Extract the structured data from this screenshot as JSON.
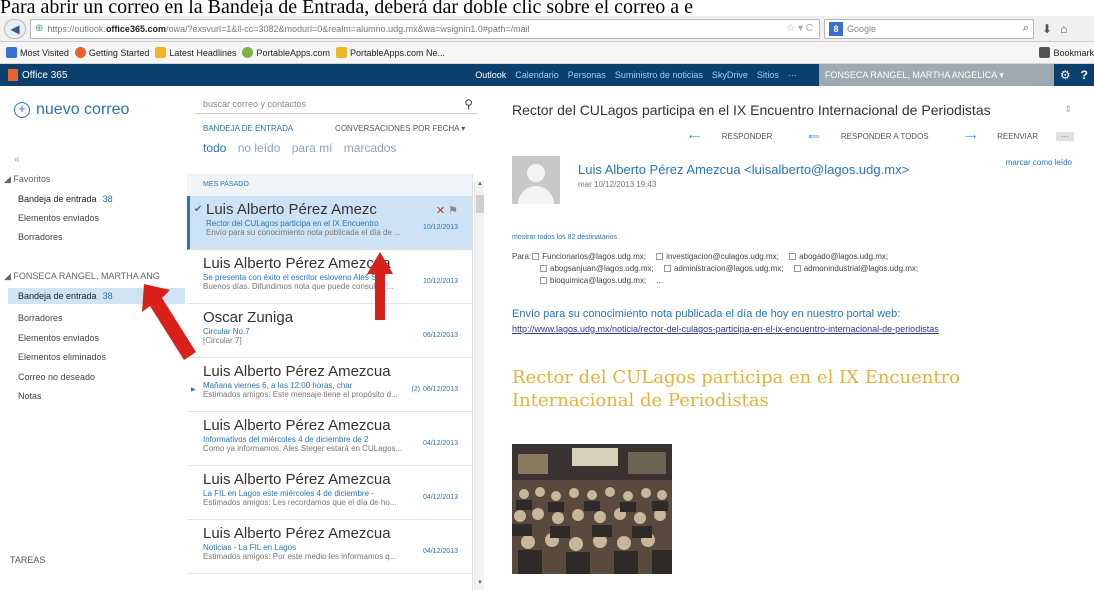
{
  "caption": "Para abrir un correo en la Bandeja de Entrada, deberá dar doble clic sobre el correo a e",
  "browser": {
    "url_prefix": "https://outlook.",
    "url_domain": "office365.com",
    "url_rest": "/owa/?exsvurl=1&ll-cc=3082&modurl=0&realm=alumno.udg.mx&wa=wsignin1.0#path=/mail",
    "search_placeholder": "Google",
    "bookmarks": [
      {
        "label": "Most Visited",
        "color": "#3b6fd1"
      },
      {
        "label": "Getting Started",
        "color": "#e8632c"
      },
      {
        "label": "Latest Headlines",
        "color": "#f0b429"
      },
      {
        "label": "PortableApps.com",
        "color": "#7cb342"
      },
      {
        "label": "PortableApps.com Ne...",
        "color": "#f0b429"
      }
    ],
    "bookmarks_right": "Bookmark"
  },
  "o365": {
    "logo": "Office 365",
    "apps": [
      "Outlook",
      "Calendario",
      "Personas",
      "Suministro de noticias",
      "SkyDrive",
      "Sitios",
      "···"
    ],
    "user": "FONSECA RANGEL, MARTHA ANGELICA ▾"
  },
  "leftnav": {
    "new_mail": "nuevo correo",
    "collapse": "«",
    "favorites_label": "◢ Favoritos",
    "favorites": [
      {
        "label": "Bandeja de entrada",
        "count": "38"
      },
      {
        "label": "Elementos enviados",
        "count": ""
      },
      {
        "label": "Borradores",
        "count": ""
      }
    ],
    "account_label": "◢ FONSECA RANGEL, MARTHA ANG",
    "folders": [
      {
        "label": "Bandeja de entrada",
        "count": "38"
      },
      {
        "label": "Borradores",
        "count": ""
      },
      {
        "label": "Elementos enviados",
        "count": ""
      },
      {
        "label": "Elementos eliminados",
        "count": ""
      },
      {
        "label": "Correo no deseado",
        "count": ""
      },
      {
        "label": "Notas",
        "count": ""
      }
    ],
    "tasks": "TAREAS"
  },
  "msglist": {
    "search_placeholder": "buscar correo y contactos",
    "folder_title": "BANDEJA DE ENTRADA",
    "sort": "CONVERSACIONES POR FECHA ▾",
    "filters": [
      "todo",
      "no leído",
      "para mí",
      "marcados"
    ],
    "group": "MES PASADO",
    "messages": [
      {
        "from": "Luis Alberto Pérez Amezc",
        "subject": "Rector del CULagos participa en el IX Encuentro",
        "preview": "Envío para su conocimiento nota publicada el día de ...",
        "date": "10/12/2013",
        "count": ""
      },
      {
        "from": "Luis Alberto Pérez Amezcua",
        "subject": "Se presenta con éxito el escritor esloveno Aleš S",
        "preview": "Buenos días. Difundimos nota que puede consultar ...",
        "date": "10/12/2013",
        "count": ""
      },
      {
        "from": "Oscar Zuniga",
        "subject": "Circular No.7",
        "preview": "[Circular 7]",
        "date": "06/12/2013",
        "count": ""
      },
      {
        "from": "Luis Alberto Pérez Amezcua",
        "subject": "Mañana viernes 6, a las 12:00 horas, char",
        "preview": "Estimados amigos: Este mensaje tiene el propósito d...",
        "date": "06/12/2013",
        "count": "(2)"
      },
      {
        "from": "Luis Alberto Pérez Amezcua",
        "subject": "Informativos del miércoles 4 de diciembre de 2",
        "preview": "Como ya informamos, Ales Steger estará en CULagos...",
        "date": "04/12/2013",
        "count": ""
      },
      {
        "from": "Luis Alberto Pérez Amezcua",
        "subject": "La FIL en Lagos este miércoles 4 de diciembre -",
        "preview": "Estimados amigos: Les recordamos que el día de ho...",
        "date": "04/12/2013",
        "count": ""
      },
      {
        "from": "Luis Alberto Pérez Amezcua",
        "subject": "Noticias - La FIL en Lagos",
        "preview": "Estimados amigos: Por este medio les informamos q...",
        "date": "04/12/2013",
        "count": ""
      }
    ]
  },
  "reading": {
    "subject": "Rector del CULagos participa en el IX Encuentro Internacional de Periodistas",
    "actions": [
      "RESPONDER",
      "RESPONDER A TODOS",
      "REENVIAR"
    ],
    "more": "···",
    "sender": "Luis Alberto Pérez Amezcua <luisalberto@lagos.udg.mx>",
    "sent_date": "mar 10/12/2013 19:43",
    "mark_read": "marcar como leído",
    "show_recipients": "mostrar todos los 82 destinatarios",
    "to_label": "Para:",
    "recipients_1": [
      "Funcionarios@lagos.udg.mx;",
      "investigacion@culagos.udg.mx;",
      "abogado@lagos.udg.mx;"
    ],
    "recipients_2": [
      "abogsanjuan@lagos.udg.mx;",
      "administracion@lagos.udg.mx;",
      "admonindustrial@lagos.udg.mx;"
    ],
    "recipients_3": [
      "bioquimica@lagos.udg.mx;"
    ],
    "recipients_more": "...",
    "body": "Envío para su conocimiento nota publicada el día de hoy en nuestro portal web:",
    "link": "http://www.lagos.udg.mx/noticia/rector-del-culagos-participa-en-el-ix-encuentro-internacional-de-periodistas",
    "headline": "Rector del CULagos participa en el IX Encuentro Internacional de Periodistas"
  },
  "colors": {
    "accent": "#2a74b6",
    "o365_bar": "#0a3f6e",
    "headline": "#e2b33c",
    "arrow": "#d9201b"
  }
}
